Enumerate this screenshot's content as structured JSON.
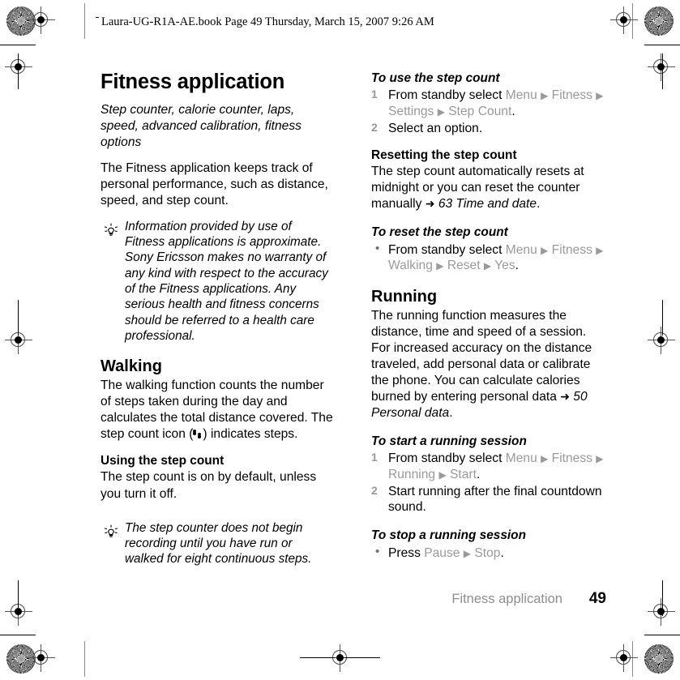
{
  "header": {
    "stamp": "Laura-UG-R1A-AE.book  Page 49  Thursday, March 15, 2007  9:26 AM"
  },
  "left_column": {
    "title": "Fitness application",
    "lead": "Step counter, calorie counter, laps, speed, advanced calibration, fitness options",
    "intro": "The Fitness application keeps track of personal performance, such as distance, speed, and step count.",
    "note1": "Information provided by use of Fitness applications is approximate. Sony Ericsson makes no warranty of any kind with respect to the accuracy of the Fitness applications. Any serious health and fitness concerns should be referred to a health care professional.",
    "walking_heading": "Walking",
    "walking_text_before_icon": "The walking function counts the number of steps taken during the day and calculates the total distance covered. The step count icon (",
    "walking_text_after_icon": ") indicates steps.",
    "using_heading": "Using the step count",
    "using_text": "The step count is on by default, unless you turn it off.",
    "note2": "The step counter does not begin recording until you have run or walked for eight continuous steps."
  },
  "right_column": {
    "proc_use_heading": "To use the step count",
    "proc_use_step1_pre": "From standby select ",
    "proc_use_step1_menu1": "Menu",
    "proc_use_step1_menu2": "Fitness",
    "proc_use_step1_menu3": "Settings",
    "proc_use_step1_menu4": "Step Count",
    "proc_use_step1_num": "1",
    "proc_use_step2_num": "2",
    "proc_use_step2": "Select an option.",
    "resetting_heading": "Resetting the step count",
    "resetting_text": "The step count automatically resets at midnight or you can reset the counter manually ",
    "resetting_xref": "63 Time and date",
    "resetting_period": ".",
    "proc_reset_heading": "To reset the step count",
    "proc_reset_pre": "From standby select ",
    "proc_reset_menu1": "Menu",
    "proc_reset_menu2": "Fitness",
    "proc_reset_menu3": "Walking",
    "proc_reset_menu4": "Reset",
    "proc_reset_menu5": "Yes",
    "running_heading": "Running",
    "running_text": "The running function measures the distance, time and speed of a session. For increased accuracy on the distance traveled, add personal data or calibrate the phone. You can calculate calories burned by entering personal data ",
    "running_xref": "50 Personal data",
    "running_period": ".",
    "proc_start_heading": "To start a running session",
    "proc_start_step1_num": "1",
    "proc_start_step1_pre": "From standby select ",
    "proc_start_menu1": "Menu",
    "proc_start_menu2": "Fitness",
    "proc_start_menu3": "Running",
    "proc_start_menu4": "Start",
    "proc_start_step2_num": "2",
    "proc_start_step2": "Start running after the final countdown sound.",
    "proc_stop_heading": "To stop a running session",
    "proc_stop_pre": "Press ",
    "proc_stop_menu1": "Pause",
    "proc_stop_menu2": "Stop"
  },
  "footer": {
    "name": "Fitness application",
    "page": "49"
  },
  "glyphs": {
    "triangle": "▶",
    "bullet": "•",
    "xref_arrow": "➜",
    "period": "."
  },
  "colors": {
    "menu_gray": "#9a9a9a",
    "footer_gray": "#8e8e8e",
    "text_black": "#000000"
  }
}
